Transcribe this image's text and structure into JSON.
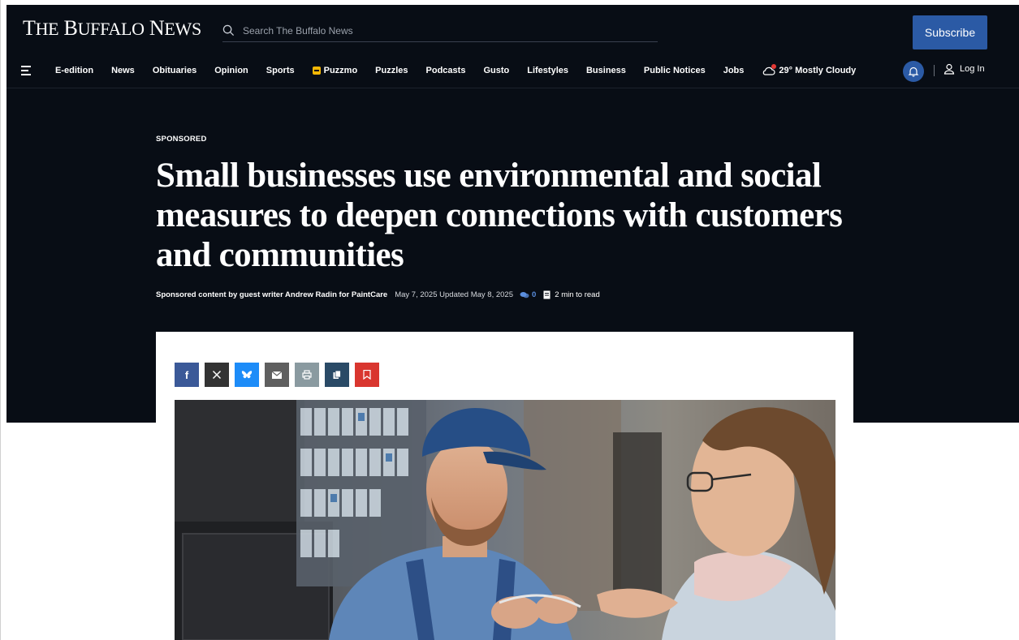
{
  "header": {
    "logo_text": "The Buffalo News",
    "search_placeholder": "Search The Buffalo News",
    "subscribe_label": "Subscribe",
    "login_label": "Log In"
  },
  "nav": {
    "items": [
      "E-edition",
      "News",
      "Obituaries",
      "Opinion",
      "Sports",
      "Puzzmo",
      "Puzzles",
      "Podcasts",
      "Gusto",
      "Lifestyles",
      "Business",
      "Public Notices",
      "Jobs"
    ],
    "weather": "29° Mostly Cloudy"
  },
  "article": {
    "kicker": "SPONSORED",
    "headline": "Small businesses use environmental and social measures to deepen connections with customers and communities",
    "author": "Sponsored content by guest writer Andrew Radin for PaintCare",
    "dates": "May 7, 2025 Updated May 8, 2025",
    "comment_count": "0",
    "read_time": "2 min to read"
  },
  "share_buttons": [
    "facebook-icon",
    "x-icon",
    "bluesky-icon",
    "email-icon",
    "print-icon",
    "copy-icon",
    "bookmark-icon"
  ],
  "colors": {
    "header_bg": "#080d15",
    "accent_blue": "#2b5aa5",
    "bookmark_red": "#d9362f"
  }
}
